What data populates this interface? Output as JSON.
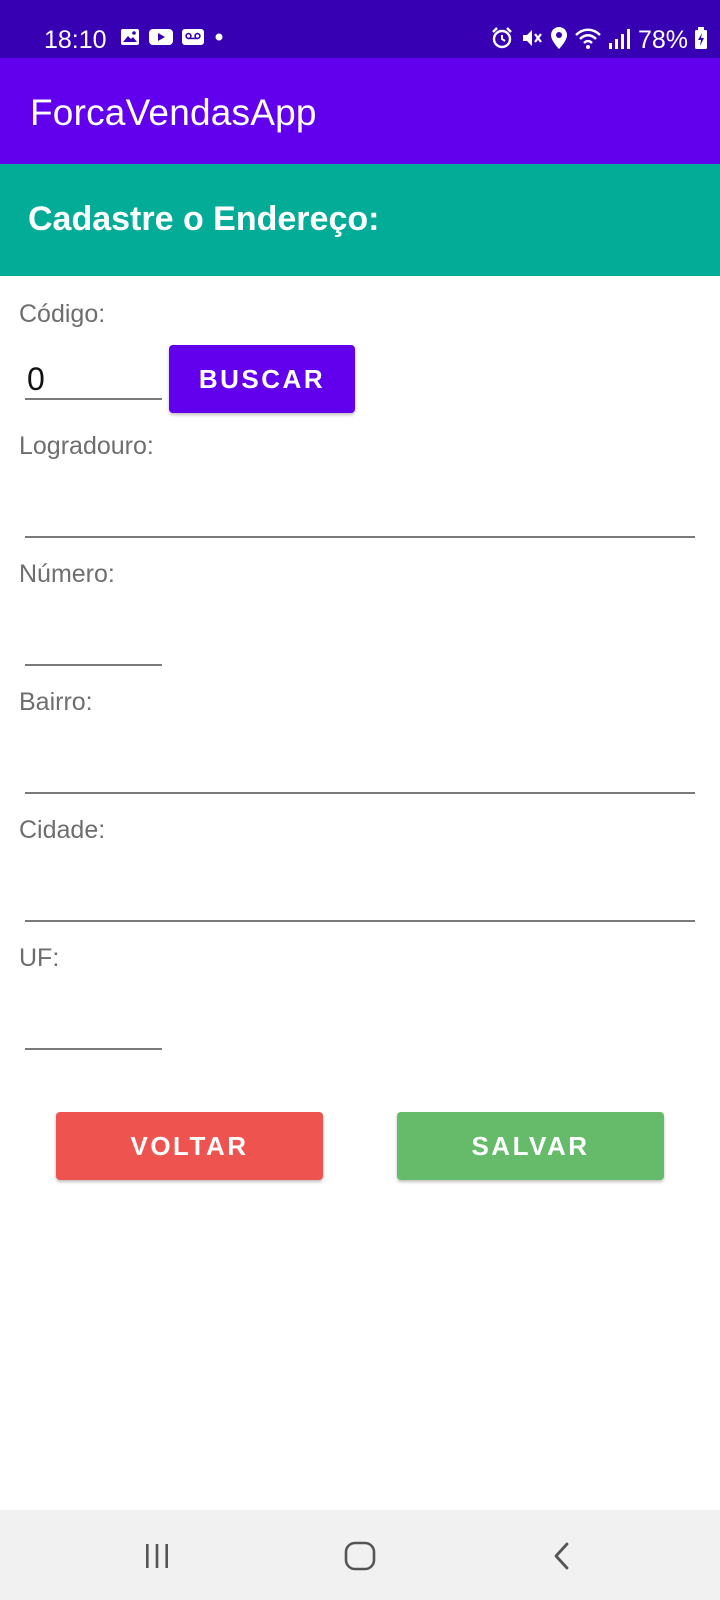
{
  "status_bar": {
    "time": "18:10",
    "battery": "78%",
    "left_icons": [
      "image-icon",
      "youtube-icon",
      "voicemail-icon",
      "dot-icon"
    ],
    "right_icons": [
      "alarm-icon",
      "mute-icon",
      "location-icon",
      "wifi-icon",
      "signal-icon",
      "battery-icon"
    ]
  },
  "app_bar": {
    "title": "ForcaVendasApp"
  },
  "header": {
    "title": "Cadastre o Endereço:"
  },
  "form": {
    "codigo": {
      "label": "Código:",
      "value": "0"
    },
    "buscar_label": "BUSCAR",
    "logradouro": {
      "label": "Logradouro:",
      "value": ""
    },
    "numero": {
      "label": "Número:",
      "value": ""
    },
    "bairro": {
      "label": "Bairro:",
      "value": ""
    },
    "cidade": {
      "label": "Cidade:",
      "value": ""
    },
    "uf": {
      "label": "UF:",
      "value": ""
    }
  },
  "actions": {
    "voltar_label": "VOLTAR",
    "salvar_label": "SALVAR"
  },
  "nav_bar": {
    "icons": [
      "recent-apps-icon",
      "home-icon",
      "back-icon"
    ]
  },
  "colors": {
    "status_bar": "#3700b3",
    "primary": "#6200ee",
    "header": "#03ac97",
    "voltar": "#ef5350",
    "salvar": "#66bb6a"
  }
}
